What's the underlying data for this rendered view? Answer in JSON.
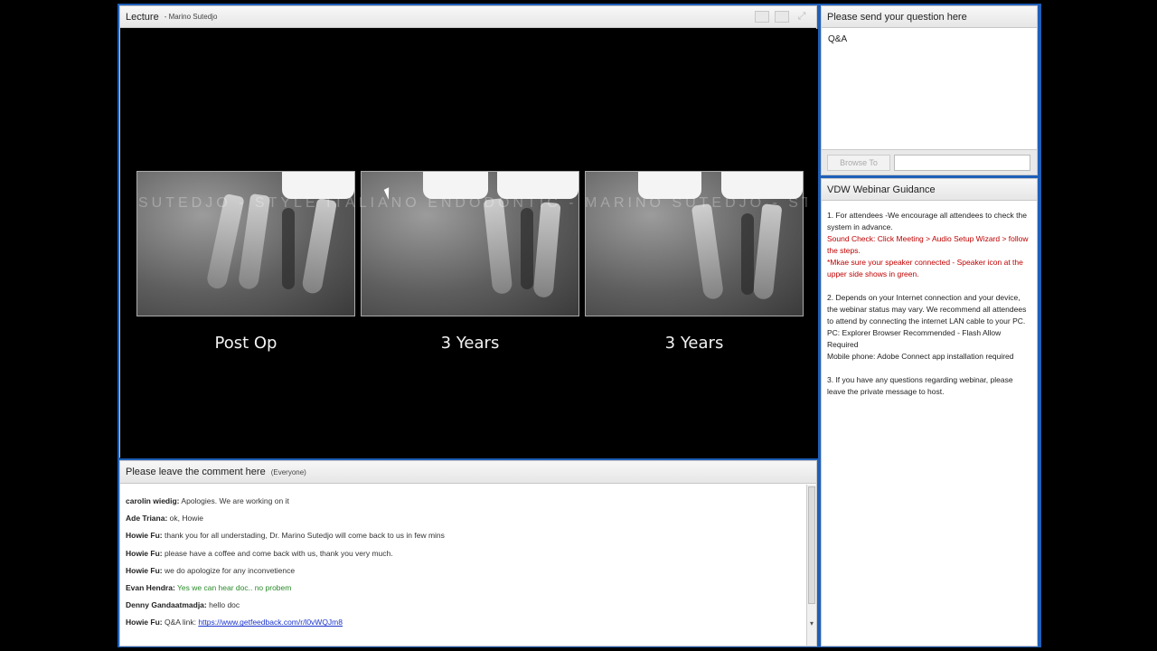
{
  "lecture": {
    "title": "Lecture",
    "presenter": "- Marino Sutedjo",
    "watermark": "SUTEDJO - STYLE ITALIANO ENDODONTIC - MARINO SUTEDJO - STYLE ITALIANO ENDO",
    "slides": [
      {
        "caption": "Post Op"
      },
      {
        "caption": "3 Years"
      },
      {
        "caption": "3 Years"
      }
    ]
  },
  "chat": {
    "title": "Please leave the comment here",
    "audience": "(Everyone)",
    "messages": [
      {
        "author": "carolin wiedig:",
        "text": "Apologies. We are working on it"
      },
      {
        "author": "Ade Triana:",
        "text": "ok, Howie"
      },
      {
        "author": "Howie Fu:",
        "text": "thank you for all understading, Dr. Marino Sutedjo will come back to us in few mins"
      },
      {
        "author": "Howie Fu:",
        "text": "please have a coffee and come back with us, thank you very much."
      },
      {
        "author": "Howie Fu:",
        "text": "we do apologize for any inconvetience"
      },
      {
        "author": "Evan Hendra:",
        "text": "Yes we can hear doc.. no probem",
        "color": "#2a8a2a"
      },
      {
        "author": "Denny Gandaatmadja:",
        "text": "hello doc"
      },
      {
        "author": "Howie Fu:",
        "text": "Q&A link:",
        "link": "https://www.getfeedback.com/r/l0vWQJm8"
      }
    ]
  },
  "qa": {
    "title": "Please send your question here",
    "body": "Q&A",
    "browse_label": "Browse To",
    "browse_value": ""
  },
  "guidance": {
    "title": "VDW Webinar Guidance",
    "p1": "1. For attendees -We encourage all attendees to check the system in advance.",
    "p1_red1": "Sound Check: Click Meeting > Audio Setup Wizard > follow the steps.",
    "p1_red2": "*Mkae sure your speaker connected - Speaker icon at the upper side shows in green.",
    "p2": "2. Depends on your Internet connection and your device, the webinar status may vary. We recommend all attendees to attend by connecting the internet LAN cable to your PC.",
    "p2_pc": "PC: Explorer Browser Recommended - Flash Allow Required",
    "p2_mobile": "Mobile phone: Adobe Connect app installation required",
    "p3": "3. If you have any questions regarding webinar, please leave the private message to host."
  },
  "colors": {
    "frame": "#1f5fb8",
    "red_text": "#c00000",
    "green_text": "#2a8a2a",
    "link": "#1a33cc"
  },
  "icons": [
    "layout-icon",
    "fullscreen-icon",
    "expand-icon"
  ]
}
